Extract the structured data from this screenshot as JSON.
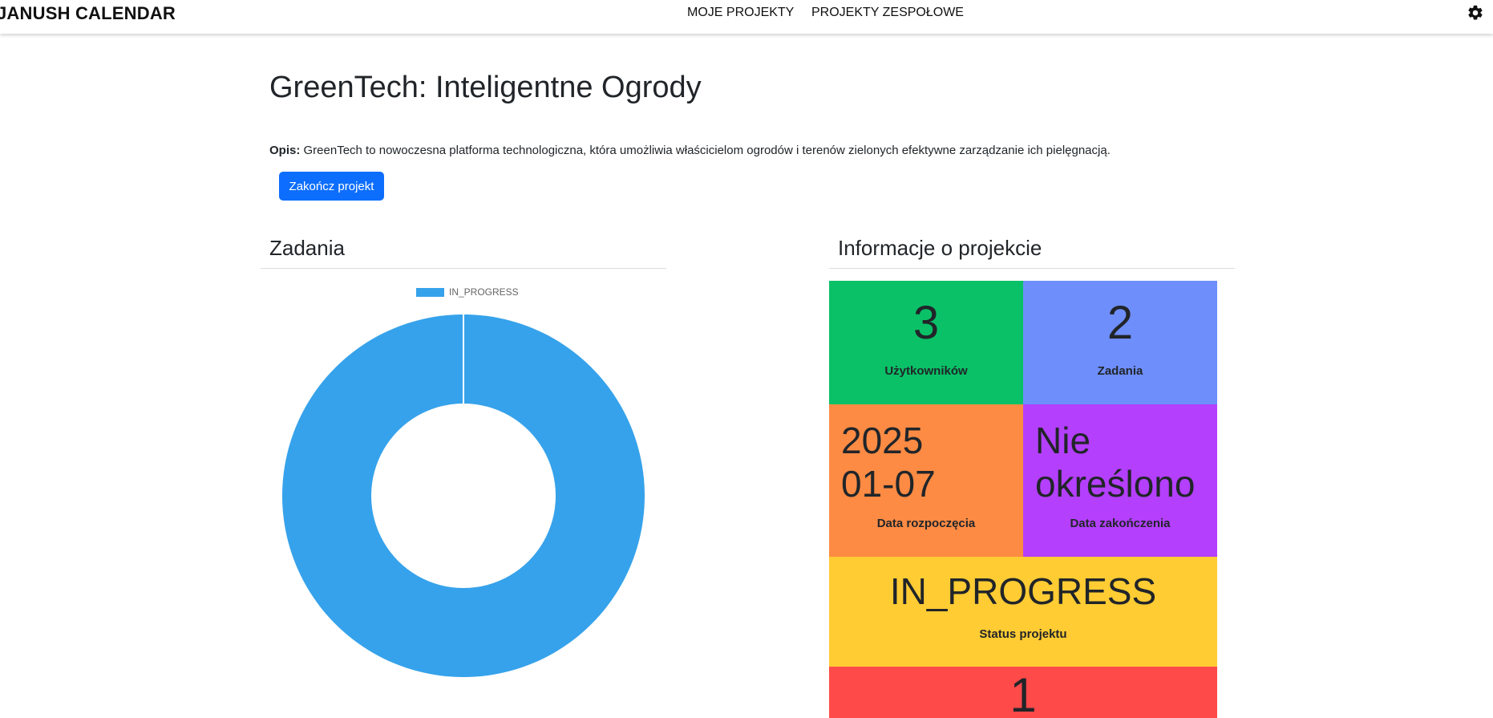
{
  "navbar": {
    "brand": "JANUSH CALENDAR",
    "links": [
      "MOJE PROJEKTY",
      "PROJEKTY ZESPOŁOWE"
    ],
    "settings_icon": "gear-icon"
  },
  "project": {
    "title": "GreenTech: Inteligentne Ogrody",
    "desc_label": "Opis:",
    "desc_text": " GreenTech to nowoczesna platforma technologiczna, która umożliwia właścicielom ogrodów i terenów zielonych efektywne zarządzanie ich pielęgnacją.",
    "finish_button": "Zakończ projekt"
  },
  "tasks_section": {
    "title": "Zadania"
  },
  "chart_data": {
    "type": "pie",
    "variant": "doughnut",
    "categories": [
      "IN_PROGRESS"
    ],
    "values": [
      2
    ],
    "colors": [
      "#36a2eb"
    ],
    "legend": "top"
  },
  "info_section": {
    "title": "Informacje o projekcie",
    "tiles": {
      "users": {
        "value": "3",
        "label": "Użytkowników",
        "color": "#0ac167"
      },
      "tasks": {
        "value": "2",
        "label": "Zadania",
        "color": "#6e8efb"
      },
      "start": {
        "value_line1": "2025",
        "value_line2": "01-07",
        "label": "Data rozpoczęcia",
        "color": "#fd8b44"
      },
      "end": {
        "value_line1": "Nie",
        "value_line2": "określono",
        "label": "Data zakończenia",
        "color": "#b43ffd"
      },
      "status": {
        "value": "IN_PROGRESS",
        "label": "Status projektu",
        "color": "#ffcc33"
      },
      "extra": {
        "value": "1",
        "color": "#ff4a4a"
      }
    }
  }
}
